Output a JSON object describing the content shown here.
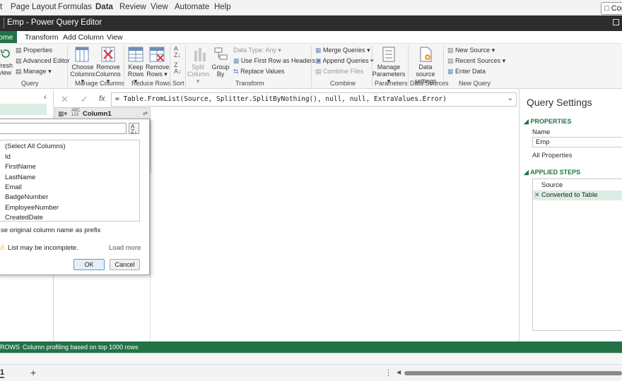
{
  "excel_menu": {
    "items": [
      "t",
      "Page Layout",
      "Formulas",
      "Data",
      "Review",
      "View",
      "Automate",
      "Help"
    ],
    "comments_label": "Com"
  },
  "title_bar": {
    "title": "Emp - Power Query Editor"
  },
  "tabs": [
    "ome",
    "Transform",
    "Add Column",
    "View"
  ],
  "ribbon": {
    "refresh": "fresh",
    "refresh2": "view",
    "properties": "Properties",
    "advanced_editor": "Advanced Editor",
    "manage": "Manage",
    "query_group": "Query",
    "choose_columns": "Choose",
    "choose_columns2": "Columns",
    "remove_columns": "Remove",
    "remove_columns2": "Columns",
    "manage_columns_group": "Manage Columns",
    "keep_rows": "Keep",
    "keep_rows2": "Rows",
    "remove_rows": "Remove",
    "remove_rows2": "Rows",
    "reduce_rows_group": "Reduce Rows",
    "sort_group": "Sort",
    "split_column": "Split",
    "split_column2": "Column",
    "group_by": "Group",
    "group_by2": "By",
    "data_type": "Data Type: Any",
    "first_row_headers": "Use First Row as Headers",
    "replace_values": "Replace Values",
    "transform_group": "Transform",
    "merge_queries": "Merge Queries",
    "append_queries": "Append Queries",
    "combine_files": "Combine Files",
    "combine_group": "Combine",
    "manage_parameters": "Manage",
    "manage_parameters2": "Parameters",
    "parameters_group": "Parameters",
    "data_source_settings": "Data source",
    "data_source_settings2": "settings",
    "data_sources_group": "Data Sources",
    "new_source": "New Source",
    "recent_sources": "Recent Sources",
    "enter_data": "Enter Data",
    "new_query_group": "New Query"
  },
  "formula": {
    "fx": "fx",
    "text": "= Table.FromList(Source, Splitter.SplitByNothing(), null, null, ExtraValues.Error)"
  },
  "column": {
    "type_badge": "ABC 123",
    "header": "Column1"
  },
  "popup": {
    "search_value": "",
    "items": [
      "(Select All Columns)",
      "Id",
      "FirstName",
      "LastName",
      "Email",
      "BadgeNumber",
      "EmployeeNumber",
      "CreatedDate"
    ],
    "prefix_label": "se original column name as prefix",
    "warning": "List may be incomplete.",
    "load_more": "Load more",
    "ok": "OK",
    "cancel": "Cancel"
  },
  "query_settings": {
    "title": "Query Settings",
    "properties_heading": "PROPERTIES",
    "name_label": "Name",
    "name_value": "Emp",
    "all_properties": "All Properties",
    "applied_steps_heading": "APPLIED STEPS",
    "steps": [
      "Source",
      "Converted to Table"
    ]
  },
  "status": {
    "rows": "ROWS",
    "profiling": "Column profiling based on top 1000 rows"
  },
  "sheet": {
    "tab": "1",
    "add": "+"
  }
}
